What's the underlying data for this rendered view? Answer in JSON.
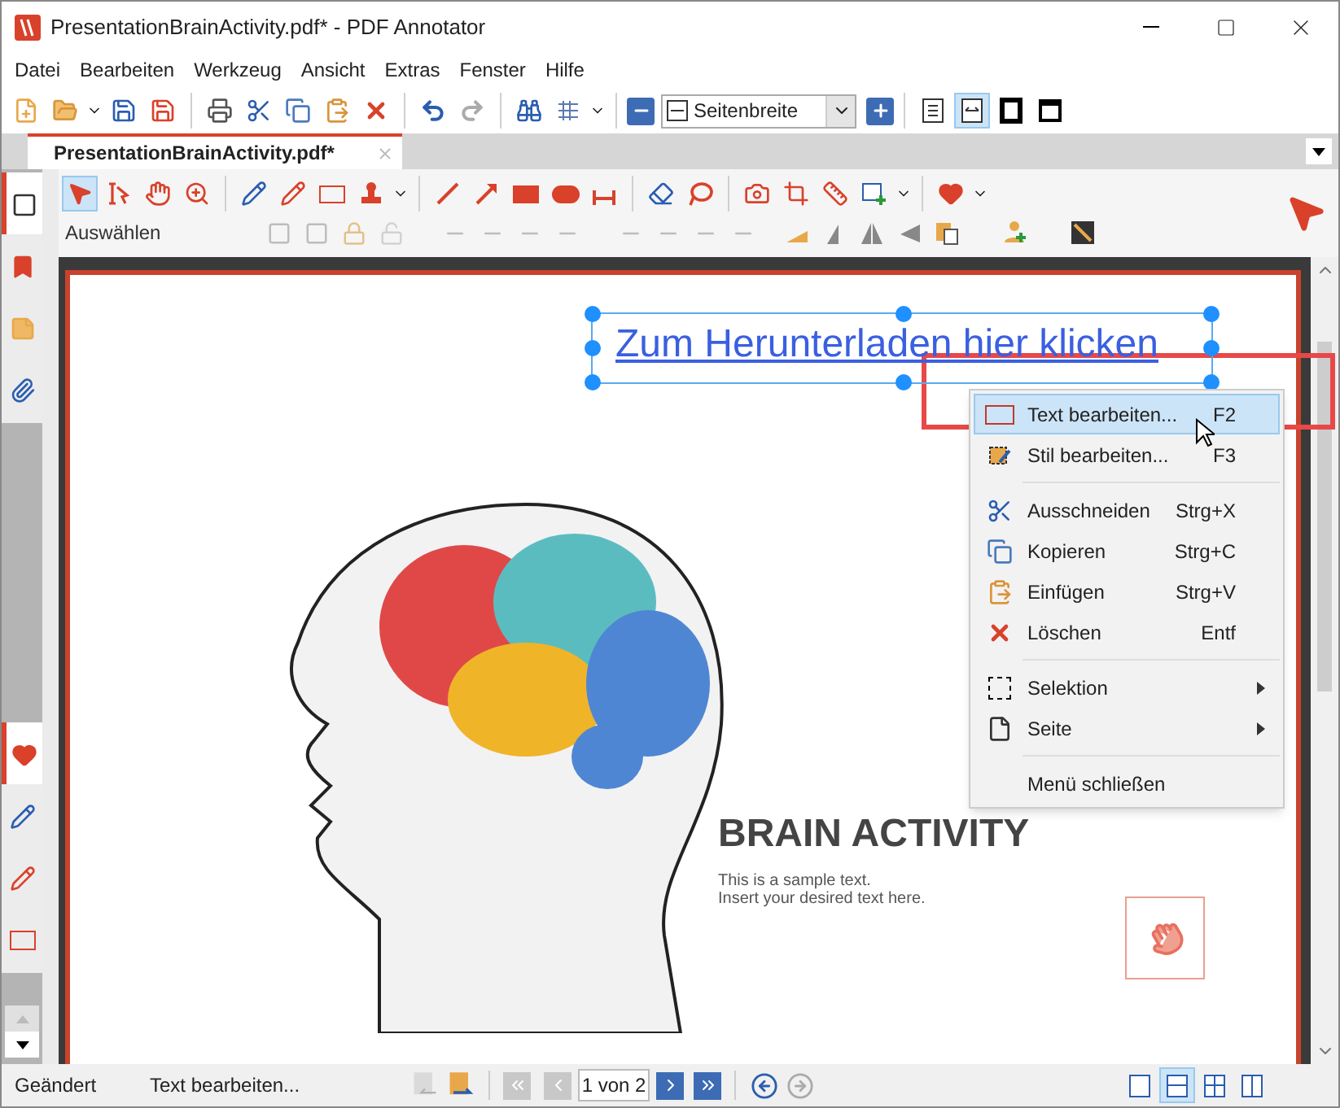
{
  "window": {
    "title": "PresentationBrainActivity.pdf* - PDF Annotator"
  },
  "menu": [
    {
      "label": "Datei"
    },
    {
      "label": "Bearbeiten"
    },
    {
      "label": "Werkzeug"
    },
    {
      "label": "Ansicht"
    },
    {
      "label": "Extras"
    },
    {
      "label": "Fenster"
    },
    {
      "label": "Hilfe"
    }
  ],
  "zoom_select": {
    "value": "Seitenbreite"
  },
  "fit_buttons": [
    {
      "kind": "page",
      "selected": false
    },
    {
      "kind": "width",
      "selected": true
    },
    {
      "kind": "full",
      "selected": false
    },
    {
      "kind": "window",
      "selected": false
    }
  ],
  "document_tabs": [
    {
      "label": "PresentationBrainActivity.pdf*",
      "selected": true
    }
  ],
  "sidebar_tabs": [
    {
      "kind": "selection",
      "selected": true
    },
    {
      "kind": "bookmark",
      "selected": false
    },
    {
      "kind": "note",
      "selected": false
    },
    {
      "kind": "attachment",
      "selected": false
    },
    {
      "kind": "favorites",
      "selected": true
    },
    {
      "kind": "pen",
      "selected": false
    },
    {
      "kind": "marker",
      "selected": false
    },
    {
      "kind": "textfield",
      "selected": false
    }
  ],
  "tools": [
    {
      "kind": "select",
      "selected": true
    },
    {
      "kind": "textselect",
      "selected": false
    },
    {
      "kind": "hand",
      "selected": false
    },
    {
      "kind": "zoom",
      "selected": false
    }
  ],
  "tool_label": "Auswählen",
  "page": {
    "link_text": "Zum Herunterladen hier klicken",
    "heading": "BRAIN ACTIVITY",
    "body": [
      "This is a sample text.",
      "Insert your desired text here."
    ]
  },
  "context_menu": [
    {
      "kind": "textedit",
      "label": "Text bearbeiten...",
      "shortcut": "F2",
      "submenu": false,
      "selected": true
    },
    {
      "kind": "style",
      "label": "Stil bearbeiten...",
      "shortcut": "F3",
      "submenu": false,
      "selected": false
    },
    {
      "kind": "separator"
    },
    {
      "kind": "cut",
      "label": "Ausschneiden",
      "shortcut": "Strg+X",
      "submenu": false,
      "selected": false
    },
    {
      "kind": "copy",
      "label": "Kopieren",
      "shortcut": "Strg+C",
      "submenu": false,
      "selected": false
    },
    {
      "kind": "paste",
      "label": "Einfügen",
      "shortcut": "Strg+V",
      "submenu": false,
      "selected": false
    },
    {
      "kind": "delete",
      "label": "Löschen",
      "shortcut": "Entf",
      "submenu": false,
      "selected": false
    },
    {
      "kind": "separator"
    },
    {
      "kind": "selection",
      "label": "Selektion",
      "submenu": true,
      "selected": false
    },
    {
      "kind": "page",
      "label": "Seite",
      "submenu": true,
      "selected": false
    },
    {
      "kind": "separator"
    },
    {
      "kind": "plain",
      "label": "Menü schließen",
      "submenu": false,
      "selected": false
    }
  ],
  "status_bar": {
    "state": "Geändert",
    "message": "Text bearbeiten...",
    "page_field": "1 von 2",
    "layouts": [
      {
        "selected": false
      },
      {
        "selected": true
      },
      {
        "selected": false
      },
      {
        "selected": false
      }
    ]
  }
}
